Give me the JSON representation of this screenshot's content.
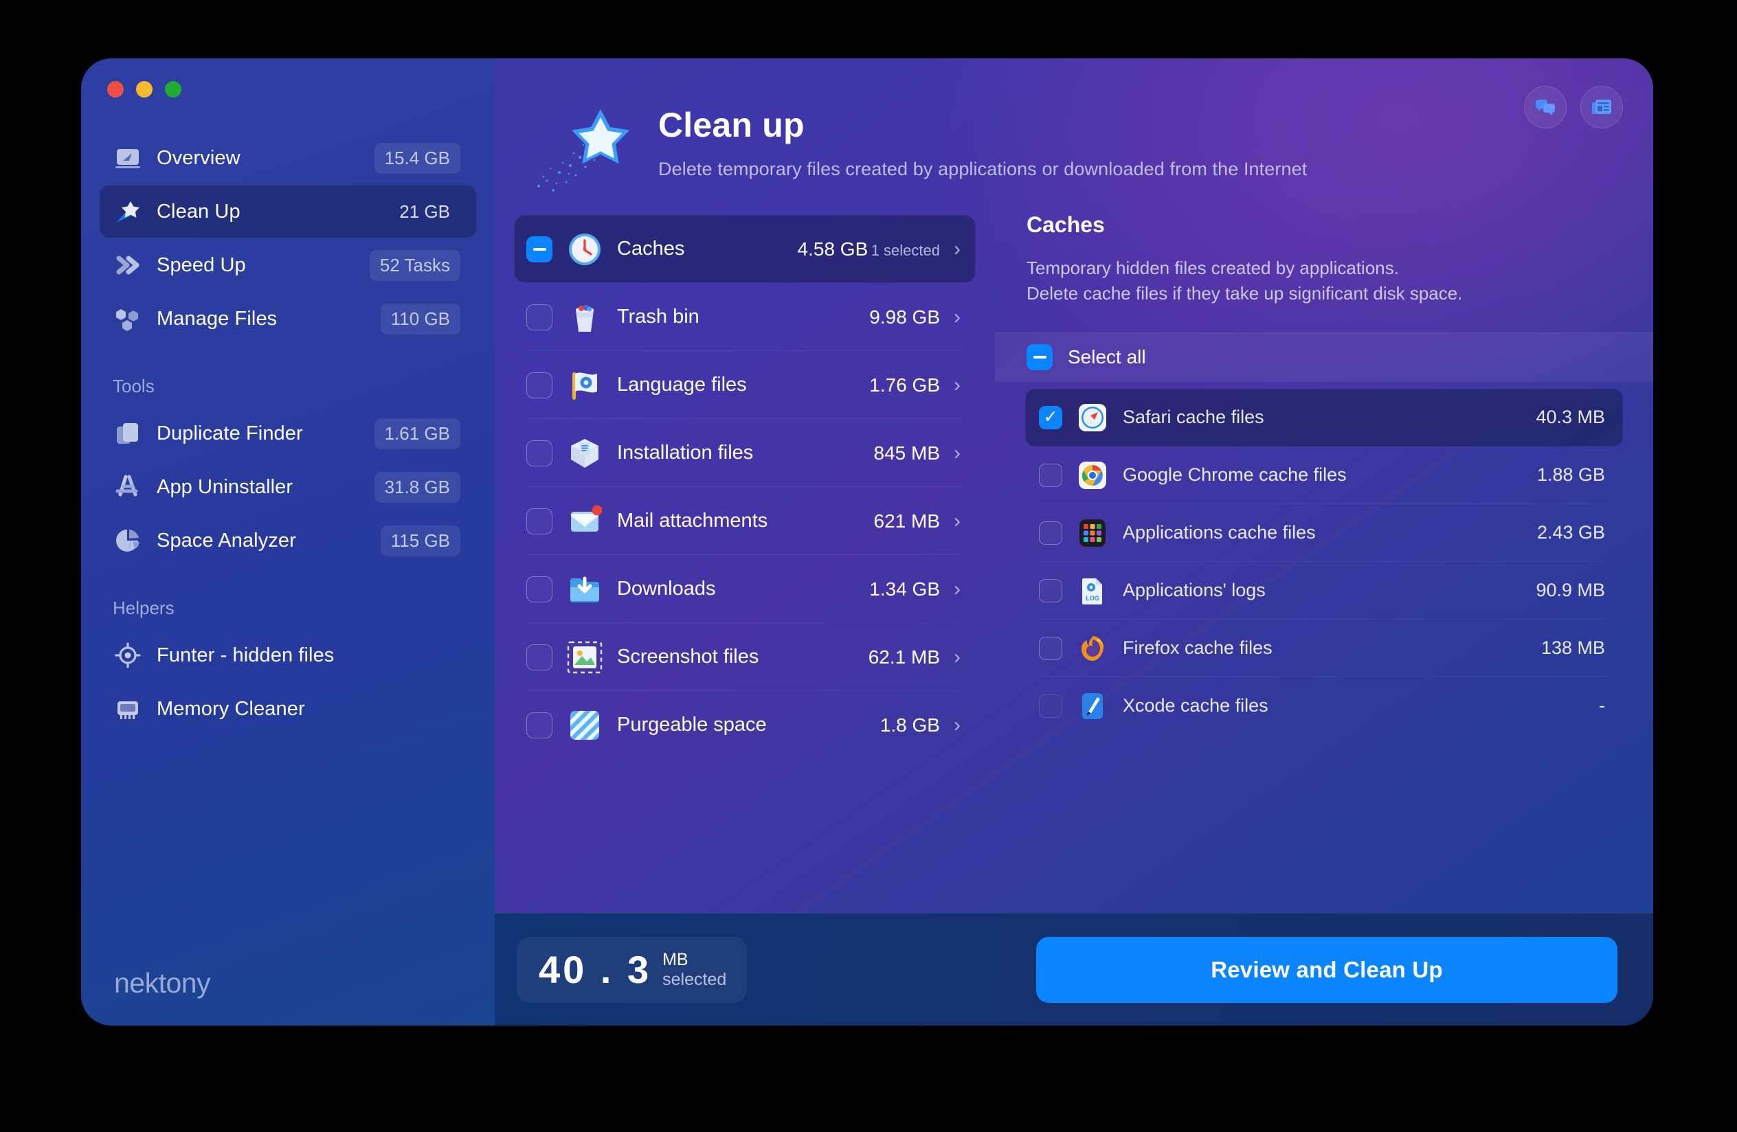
{
  "window": {
    "traffic_lights": [
      "close",
      "minimize",
      "zoom"
    ],
    "brand": "nektony"
  },
  "header": {
    "title": "Clean up",
    "subtitle": "Delete temporary files created by applications or downloaded from the Internet",
    "icon": "shooting-star-icon",
    "actions": [
      {
        "name": "support-chat-button",
        "icon": "chat-bubbles-icon"
      },
      {
        "name": "news-button",
        "icon": "news-article-icon"
      }
    ]
  },
  "sidebar": {
    "main_items": [
      {
        "label": "Overview",
        "badge": "15.4 GB",
        "icon": "dashboard-icon",
        "active": false
      },
      {
        "label": "Clean Up",
        "badge": "21 GB",
        "icon": "broom-star-icon",
        "active": true
      },
      {
        "label": "Speed Up",
        "badge": "52 Tasks",
        "icon": "double-chevron-icon",
        "active": false
      },
      {
        "label": "Manage Files",
        "badge": "110 GB",
        "icon": "hexagons-icon",
        "active": false
      }
    ],
    "tools_header": "Tools",
    "tools_items": [
      {
        "label": "Duplicate Finder",
        "badge": "1.61 GB",
        "icon": "documents-icon"
      },
      {
        "label": "App Uninstaller",
        "badge": "31.8 GB",
        "icon": "app-store-icon"
      },
      {
        "label": "Space Analyzer",
        "badge": "115 GB",
        "icon": "pie-chart-icon"
      }
    ],
    "helpers_header": "Helpers",
    "helpers_items": [
      {
        "label": "Funter - hidden files",
        "badge": "",
        "icon": "target-icon"
      },
      {
        "label": "Memory Cleaner",
        "badge": "",
        "icon": "memory-chip-icon"
      }
    ]
  },
  "categories": [
    {
      "label": "Caches",
      "size": "4.58 GB",
      "sub": "1 selected",
      "checkbox": "partial",
      "selected": true,
      "icon": "clock-icon"
    },
    {
      "label": "Trash bin",
      "size": "9.98 GB",
      "sub": "",
      "checkbox": "unchecked",
      "selected": false,
      "icon": "trash-icon"
    },
    {
      "label": "Language files",
      "size": "1.76 GB",
      "sub": "",
      "checkbox": "unchecked",
      "selected": false,
      "icon": "flag-gear-icon"
    },
    {
      "label": "Installation files",
      "size": "845 MB",
      "sub": "",
      "checkbox": "unchecked",
      "selected": false,
      "icon": "open-box-icon"
    },
    {
      "label": "Mail attachments",
      "size": "621 MB",
      "sub": "",
      "checkbox": "unchecked",
      "selected": false,
      "icon": "mail-badge-icon"
    },
    {
      "label": "Downloads",
      "size": "1.34 GB",
      "sub": "",
      "checkbox": "unchecked",
      "selected": false,
      "icon": "download-folder-icon"
    },
    {
      "label": "Screenshot files",
      "size": "62.1 MB",
      "sub": "",
      "checkbox": "unchecked",
      "selected": false,
      "icon": "screenshot-icon"
    },
    {
      "label": "Purgeable space",
      "size": "1.8 GB",
      "sub": "",
      "checkbox": "unchecked",
      "selected": false,
      "icon": "hatched-square-icon"
    }
  ],
  "detail": {
    "title": "Caches",
    "description_line1": "Temporary hidden files created by applications.",
    "description_line2": "Delete cache files if they take up significant disk space.",
    "select_all_label": "Select all",
    "select_all_state": "partial",
    "files": [
      {
        "label": "Safari cache files",
        "size": "40.3 MB",
        "checkbox": "checked",
        "selected": true,
        "icon": "safari-icon"
      },
      {
        "label": "Google Chrome cache files",
        "size": "1.88 GB",
        "checkbox": "unchecked",
        "selected": false,
        "icon": "chrome-icon"
      },
      {
        "label": "Applications cache files",
        "size": "2.43 GB",
        "checkbox": "unchecked",
        "selected": false,
        "icon": "applications-grid-icon"
      },
      {
        "label": "Applications' logs",
        "size": "90.9 MB",
        "checkbox": "unchecked",
        "selected": false,
        "icon": "log-file-icon"
      },
      {
        "label": "Firefox cache files",
        "size": "138 MB",
        "checkbox": "unchecked",
        "selected": false,
        "icon": "firefox-icon"
      },
      {
        "label": "Xcode cache files",
        "size": "-",
        "checkbox": "disabled",
        "selected": false,
        "icon": "xcode-icon"
      }
    ]
  },
  "footer": {
    "size_number": "40 . 3",
    "size_unit": "MB",
    "size_selected_label": "selected",
    "primary_button": "Review and Clean Up"
  },
  "colors": {
    "accent": "#0a84ff",
    "sidebar_start": "#2d3ea2",
    "sidebar_end": "#1a458f",
    "footer": "#123375",
    "text_primary": "#ffffff",
    "text_muted": "#c0bde4"
  }
}
